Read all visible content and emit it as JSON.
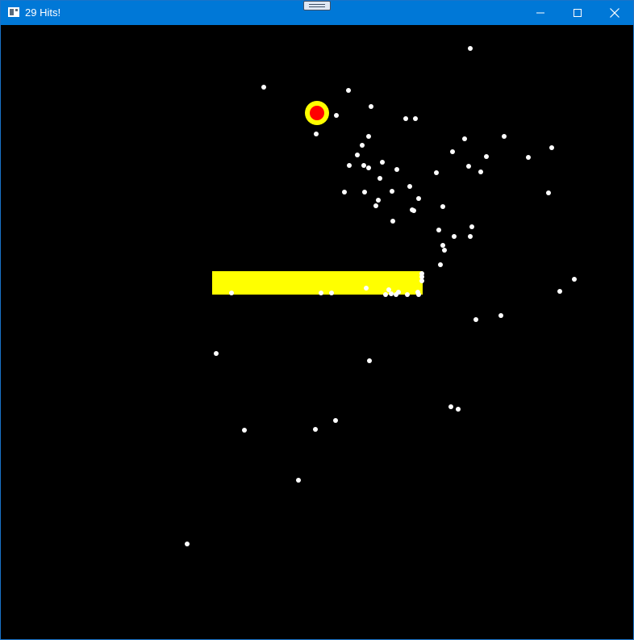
{
  "window": {
    "title": "29 Hits!",
    "titlebar_color": "#0078d7",
    "title_icon": "app-window-icon",
    "controls": {
      "minimize_icon": "minimize-icon",
      "maximize_icon": "maximize-icon",
      "close_icon": "close-icon"
    }
  },
  "game": {
    "background_color": "#000000",
    "paddle_color": "#ffff00",
    "ball_ring_color": "#ffff00",
    "ball_core_color": "#ff0000",
    "particle_color": "#ffffff"
  }
}
